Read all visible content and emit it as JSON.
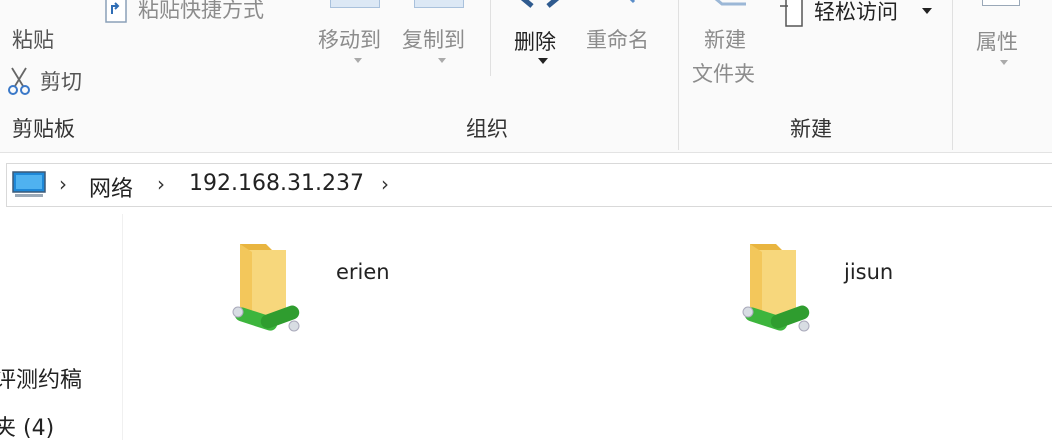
{
  "ribbon": {
    "clipboard": {
      "paste_label": "粘贴",
      "paste_shortcut_label": "粘贴快捷方式",
      "cut_label": "剪切",
      "group_label": "剪贴板"
    },
    "organize": {
      "move_to_label": "移动到",
      "copy_to_label": "复制到",
      "delete_label": "删除",
      "rename_label": "重命名",
      "group_label": "组织"
    },
    "new": {
      "new_folder_line1": "新建",
      "new_folder_line2": "文件夹",
      "easy_access_label": "轻松访问",
      "group_label": "新建"
    },
    "open": {
      "properties_label": "属性"
    }
  },
  "address_bar": {
    "icon": "computer-icon",
    "crumbs": [
      "网络",
      "192.168.31.237"
    ]
  },
  "nav": {
    "items": [
      "评测约稿",
      "夹 (4)"
    ]
  },
  "content": {
    "items": [
      {
        "name": "erien",
        "icon": "network-share-folder-icon"
      },
      {
        "name": "jisun",
        "icon": "network-share-folder-icon"
      }
    ]
  },
  "colors": {
    "folder": "#f3c75b",
    "share_green": "#3db53d",
    "computer_blue": "#1e88d8"
  }
}
